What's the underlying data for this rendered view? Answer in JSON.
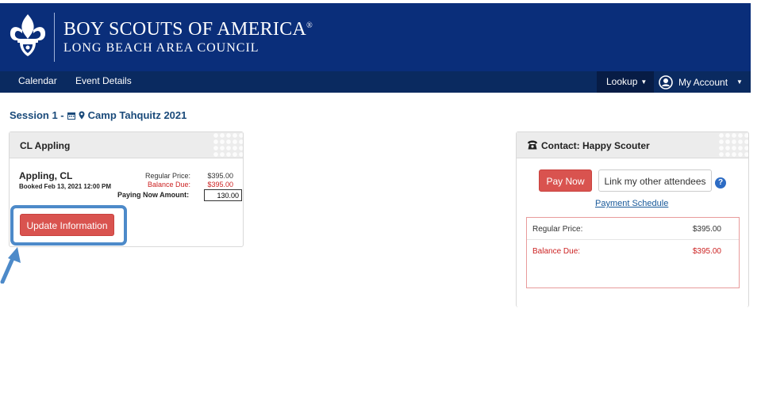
{
  "header": {
    "org_name": "BOY SCOUTS OF AMERICA",
    "registered_mark": "®",
    "council": "LONG BEACH AREA COUNCIL",
    "logo_icon": "fleur-de-lis-icon"
  },
  "nav": {
    "items": [
      {
        "label": "Calendar"
      },
      {
        "label": "Event Details"
      }
    ],
    "lookup_label": "Lookup",
    "account_label": "My Account"
  },
  "session": {
    "prefix": "Session 1 -",
    "camp": "Camp Tahquitz 2021"
  },
  "attendee_panel": {
    "title": "CL Appling",
    "name": "Appling, CL",
    "booked": "Booked Feb 13, 2021 12:00 PM",
    "regular_price_label": "Regular Price:",
    "regular_price_value": "$395.00",
    "balance_due_label": "Balance Due:",
    "balance_due_value": "$395.00",
    "paying_now_label": "Paying Now Amount:",
    "paying_now_value": "130.00",
    "update_label": "Update Information"
  },
  "contact_panel": {
    "title": "Contact: Happy Scouter",
    "pay_now_label": "Pay Now",
    "link_label": "Link my other attendees",
    "help_label": "?",
    "schedule_label": "Payment Schedule",
    "regular_price_label": "Regular Price:",
    "regular_price_value": "$395.00",
    "balance_due_label": "Balance Due:",
    "balance_due_value": "$395.00"
  },
  "colors": {
    "header_bg": "#0a2e7a",
    "nav_bg": "#0a2a60",
    "accent_red": "#d9534f",
    "balance_red": "#cc2222",
    "highlight_blue": "#4d8ac9"
  }
}
